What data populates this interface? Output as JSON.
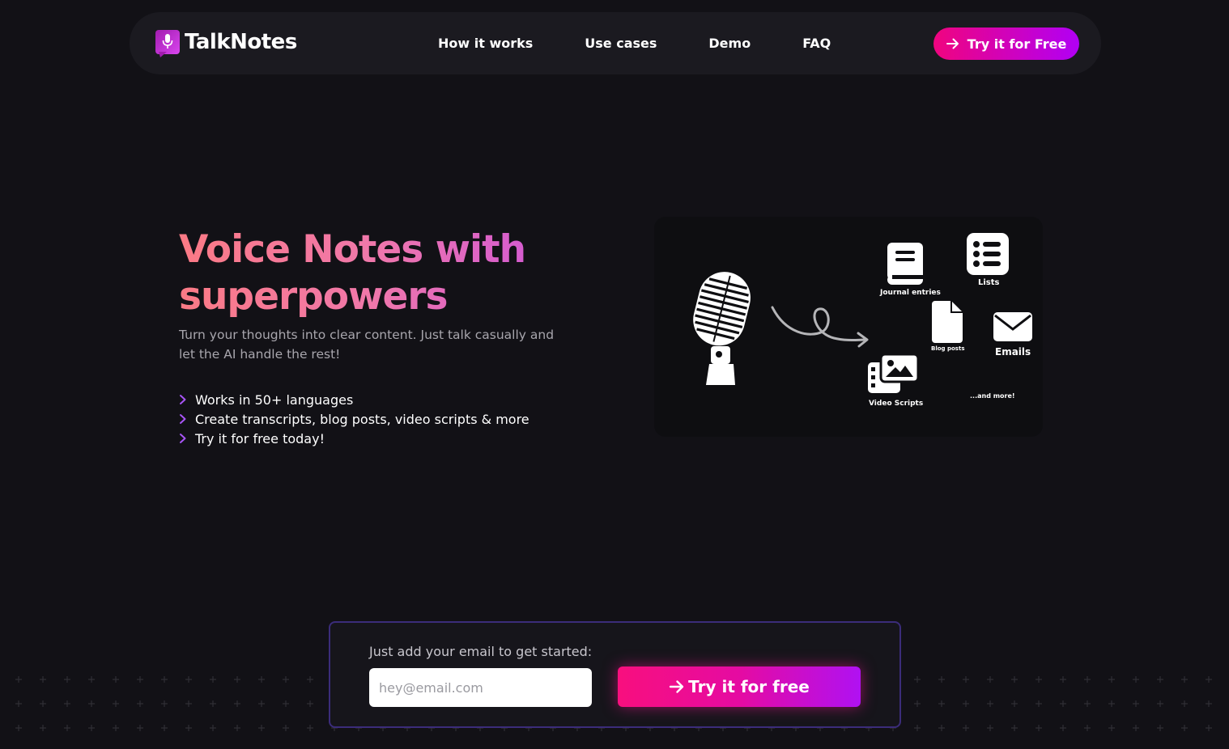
{
  "brand": {
    "name": "TalkNotes",
    "logo_icon": "microphone-icon",
    "accent_from": "#f0047f",
    "accent_to": "#b100f5"
  },
  "nav": {
    "links": [
      "How it works",
      "Use cases",
      "Demo",
      "FAQ"
    ],
    "cta_label": "Try it for Free",
    "cta_icon": "arrow-right-icon"
  },
  "hero": {
    "title_line1": "Voice Notes with",
    "title_line2": "superpowers",
    "subtitle_line1": "Turn your thoughts into clear content. Just talk casually and",
    "subtitle_line2": "let the AI handle the rest!",
    "bullets": [
      "Works in 50+ languages",
      "Create transcripts, blog posts, video scripts & more",
      "Try it for free today!"
    ],
    "bullet_icon": "chevron-right-icon"
  },
  "illustration": {
    "outputs": [
      {
        "label": "Journal entries",
        "icon": "book-icon"
      },
      {
        "label": "Lists",
        "icon": "list-icon"
      },
      {
        "label": "Blog posts",
        "icon": "file-icon"
      },
      {
        "label": "Emails",
        "icon": "envelope-icon"
      },
      {
        "label": "Video Scripts",
        "icon": "images-icon"
      },
      {
        "label": "...and more!",
        "icon": ""
      }
    ],
    "source_icon": "microphone-icon",
    "connector_icon": "curly-arrow-icon"
  },
  "signup": {
    "prompt": "Just add your email to get started:",
    "email_placeholder": "hey@email.com",
    "email_value": "",
    "cta_label": "Try it for free",
    "cta_icon": "arrow-right-icon"
  },
  "colors": {
    "background": "#121116",
    "nav_background": "#1b1a20",
    "signup_border": "#3b2c7a"
  }
}
